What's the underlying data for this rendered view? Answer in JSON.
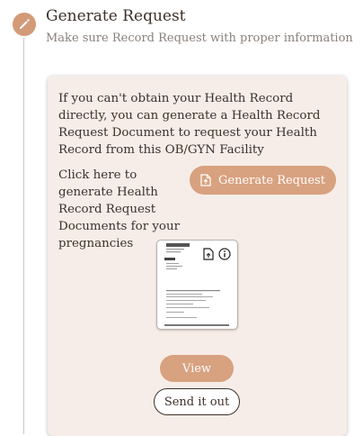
{
  "step": {
    "icon": "pencil-icon",
    "title": "Generate Request",
    "subtitle": "Make sure Record Request with proper information"
  },
  "card": {
    "intro_text": "If you can't obtain your Health Record directly, you can generate a Health Record Request Document to request your Health Record from this OB/GYN Facility",
    "click_text": "Click here to generate Health Record Request Documents for your pregnancies",
    "generate_button": {
      "label": "Generate Request",
      "icon": "file-upload-icon"
    },
    "document_preview": {
      "icons": [
        "file-upload-icon",
        "info-icon"
      ]
    },
    "view_button": "View",
    "send_button": "Send it out"
  },
  "colors": {
    "accent": "#d8a17f",
    "card_background": "#f6ede8",
    "text": "#3f3029",
    "muted_text": "#8a807b"
  }
}
